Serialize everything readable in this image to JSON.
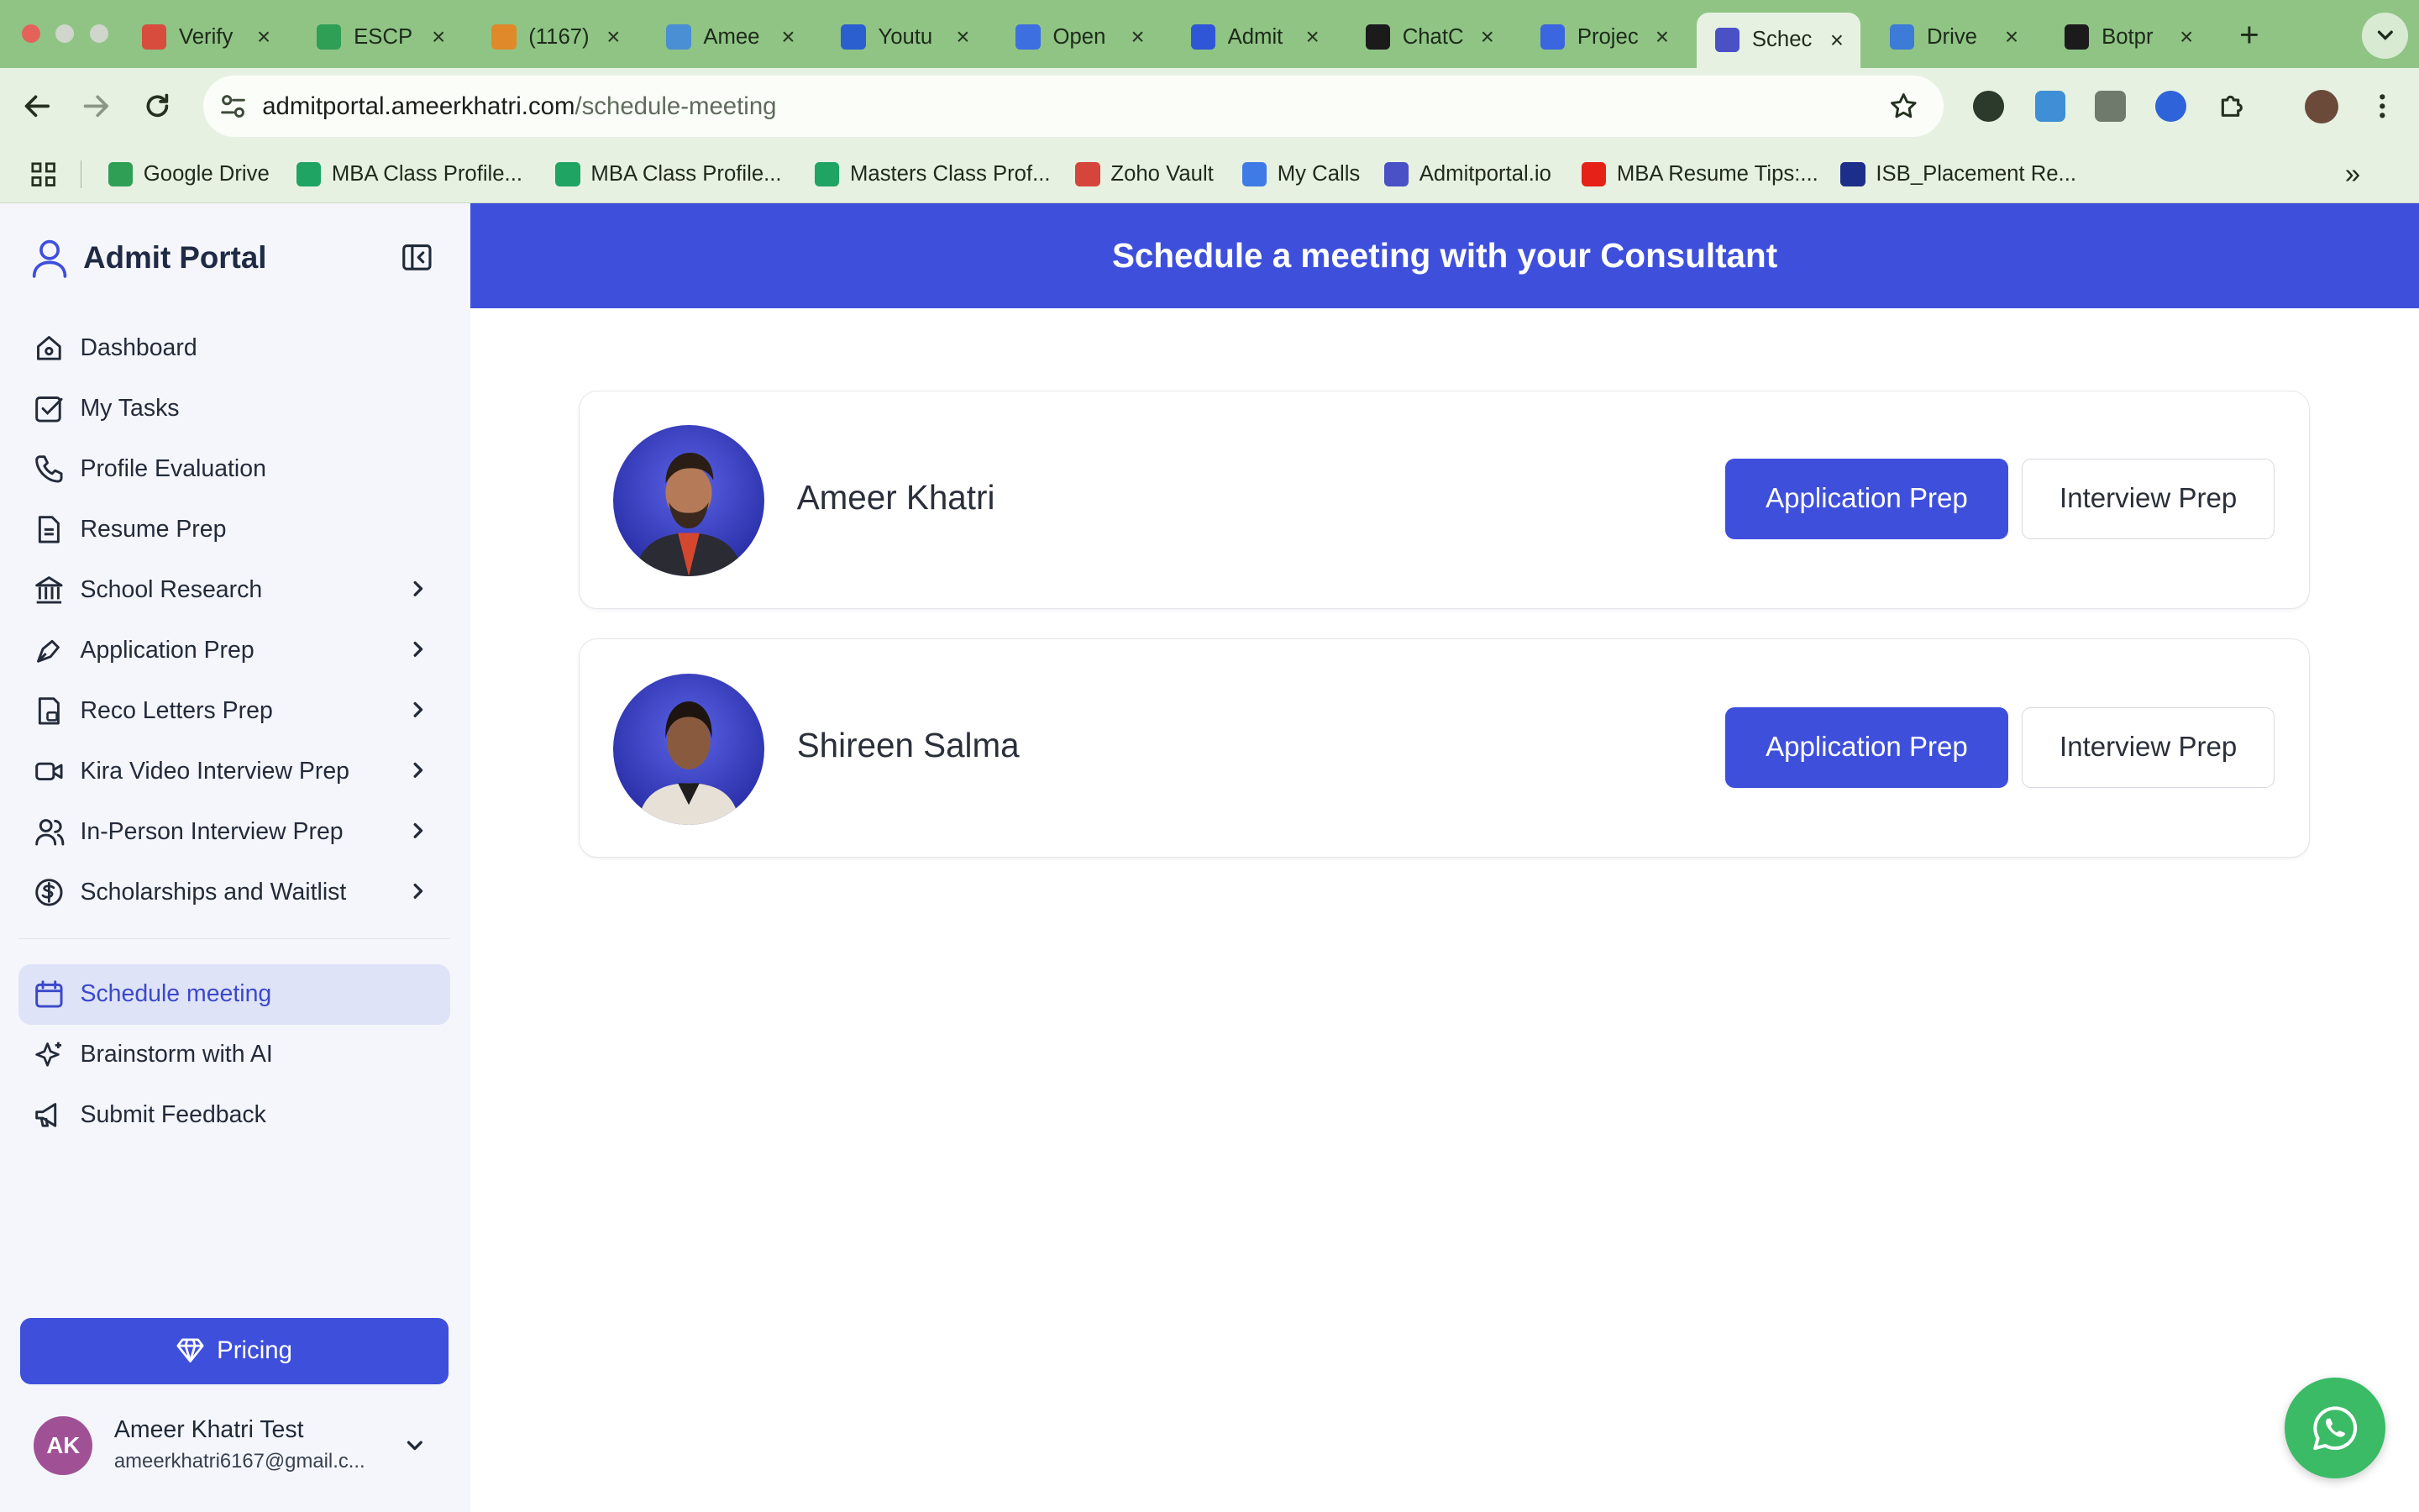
{
  "browser": {
    "tabs": [
      {
        "label": "Verify",
        "icon": "gmail-icon",
        "color": "#d84c3e"
      },
      {
        "label": "ESCP",
        "icon": "google-drive-icon",
        "color": "#2f9f55"
      },
      {
        "label": "(1167)",
        "icon": "notification-icon",
        "color": "#e0892a"
      },
      {
        "label": "Amee",
        "icon": "users-icon",
        "color": "#4a8ed4"
      },
      {
        "label": "Youtu",
        "icon": "yo-icon",
        "color": "#2b5fd0"
      },
      {
        "label": "Open",
        "icon": "openai-icon",
        "color": "#3e6fe0"
      },
      {
        "label": "Admit",
        "icon": "mountain-icon",
        "color": "#2f56d6"
      },
      {
        "label": "ChatC",
        "icon": "chatgpt-icon",
        "color": "#1b1b1b"
      },
      {
        "label": "Projec",
        "icon": "c-icon",
        "color": "#3a66e0"
      },
      {
        "label": "Schec",
        "icon": "admitportal-icon",
        "color": "#4a50c6"
      },
      {
        "label": "Drive",
        "icon": "doc-icon",
        "color": "#3c7bd6"
      },
      {
        "label": "Botpr",
        "icon": "share-icon",
        "color": "#1b1b1b"
      }
    ],
    "active_tab_index": 9,
    "tab_close": "×",
    "new_tab": "+",
    "url_host": "admitportal.ameerkhatri.com",
    "url_path": "/schedule-meeting",
    "bookmarks": [
      {
        "label": "Google Drive",
        "color": "#2f9f55"
      },
      {
        "label": "MBA Class Profile...",
        "color": "#1fa463"
      },
      {
        "label": "MBA Class Profile...",
        "color": "#1fa463"
      },
      {
        "label": "Masters Class Prof...",
        "color": "#1fa463"
      },
      {
        "label": "Zoho Vault",
        "color": "#d6453b"
      },
      {
        "label": "My Calls",
        "color": "#3f7be6"
      },
      {
        "label": "Admitportal.io",
        "color": "#4a50c6"
      },
      {
        "label": "MBA Resume Tips:...",
        "color": "#e62117"
      },
      {
        "label": "ISB_Placement Re...",
        "color": "#1b2e8a"
      }
    ],
    "bookmarks_more": "»"
  },
  "sidebar": {
    "title": "Admit Portal",
    "items": [
      {
        "label": "Dashboard",
        "icon": "home-icon",
        "has_chevron": false
      },
      {
        "label": "My Tasks",
        "icon": "checkbox-icon",
        "has_chevron": false
      },
      {
        "label": "Profile Evaluation",
        "icon": "phone-icon",
        "has_chevron": false
      },
      {
        "label": "Resume Prep",
        "icon": "document-icon",
        "has_chevron": false
      },
      {
        "label": "School Research",
        "icon": "bank-icon",
        "has_chevron": true
      },
      {
        "label": "Application Prep",
        "icon": "pen-icon",
        "has_chevron": true
      },
      {
        "label": "Reco Letters Prep",
        "icon": "file-lock-icon",
        "has_chevron": true
      },
      {
        "label": "Kira Video Interview Prep",
        "icon": "video-icon",
        "has_chevron": true
      },
      {
        "label": "In-Person Interview Prep",
        "icon": "users-icon",
        "has_chevron": true
      },
      {
        "label": "Scholarships and Waitlist",
        "icon": "dollar-icon",
        "has_chevron": true
      }
    ],
    "secondary_items": [
      {
        "label": "Schedule meeting",
        "icon": "calendar-icon",
        "active": true
      },
      {
        "label": "Brainstorm with AI",
        "icon": "sparkles-icon",
        "active": false
      },
      {
        "label": "Submit Feedback",
        "icon": "megaphone-icon",
        "active": false
      }
    ],
    "pricing_label": "Pricing",
    "user": {
      "initials": "AK",
      "name": "Ameer Khatri Test",
      "email": "ameerkhatri6167@gmail.c..."
    }
  },
  "main": {
    "banner_title": "Schedule a meeting with your Consultant",
    "consultants": [
      {
        "name": "Ameer Khatri",
        "primary_label": "Application Prep",
        "secondary_label": "Interview Prep"
      },
      {
        "name": "Shireen Salma",
        "primary_label": "Application Prep",
        "secondary_label": "Interview Prep"
      }
    ]
  },
  "colors": {
    "accent": "#3e4fdc",
    "sidebar_bg": "#f5f6fb",
    "active_nav_bg": "#dfe3f8",
    "whatsapp": "#3bbb66",
    "browser_frame": "#8fc485"
  }
}
